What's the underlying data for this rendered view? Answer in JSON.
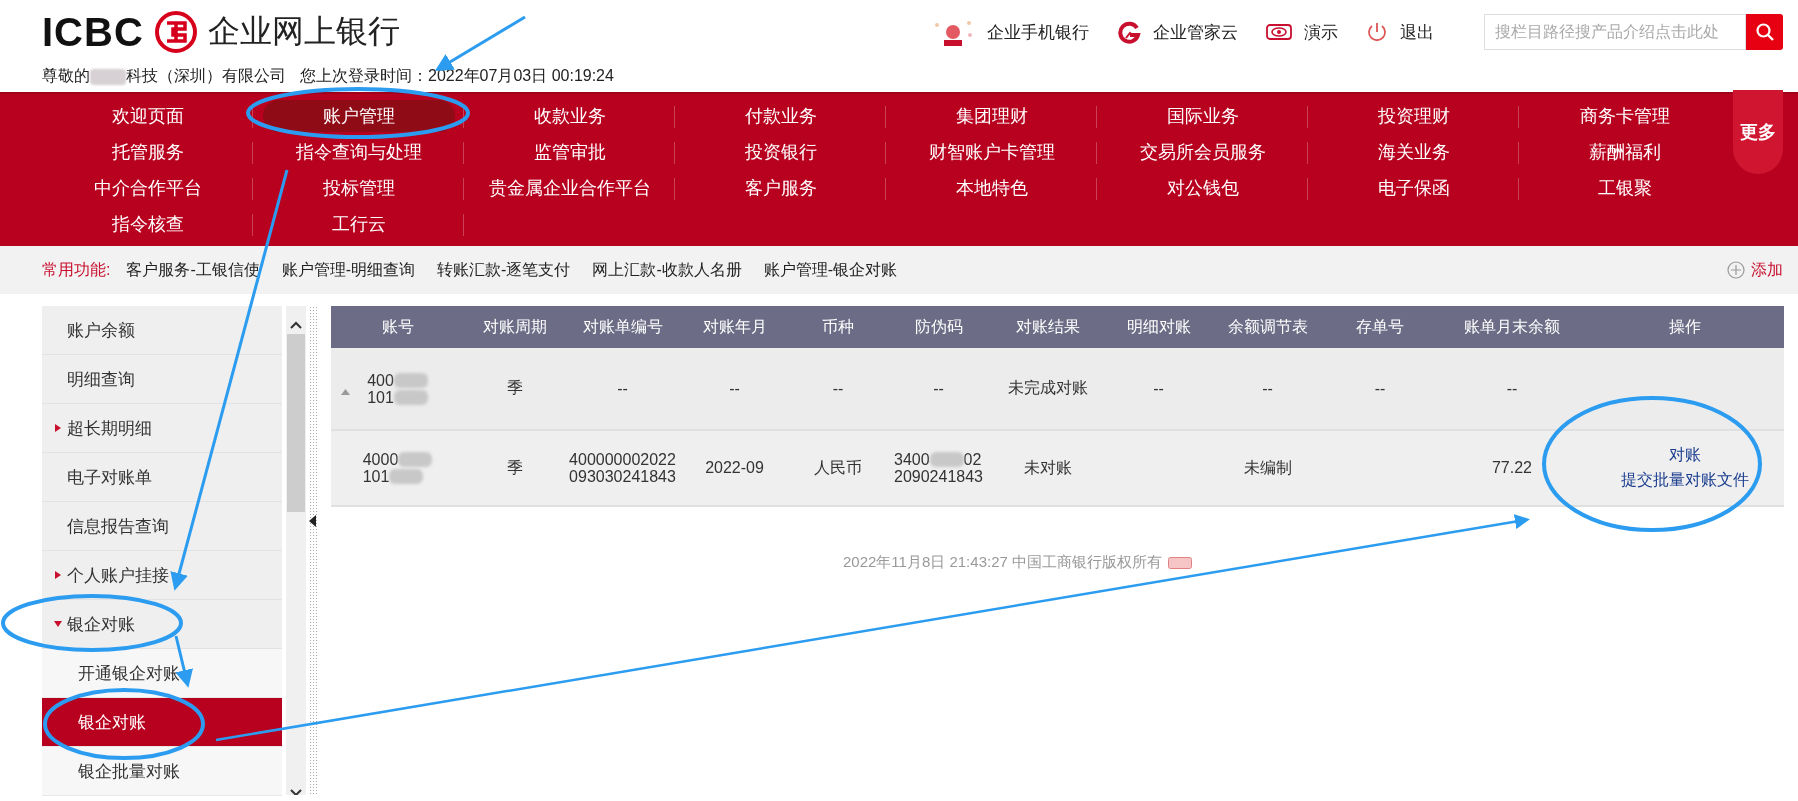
{
  "header": {
    "logo_text": "ICBC",
    "product": "企业网上银行",
    "greeting": {
      "before": "尊敬的",
      "redacted": true,
      "after": "科技（深圳）有限公司",
      "last_login_label": "您上次登录时间：",
      "last_login": "2022年07月03日 00:19:24"
    },
    "links": [
      {
        "kind": "mobile",
        "label": "企业手机银行"
      },
      {
        "kind": "cloud",
        "label": "企业管家云"
      },
      {
        "kind": "eye",
        "label": "演示"
      },
      {
        "kind": "power",
        "label": "退出"
      }
    ],
    "search": {
      "placeholder": "搜栏目路径搜产品介绍点击此处"
    }
  },
  "nav": {
    "items": [
      {
        "label": "欢迎页面",
        "selected": false
      },
      {
        "label": "账户管理",
        "selected": true
      },
      {
        "label": "收款业务",
        "selected": false
      },
      {
        "label": "付款业务",
        "selected": false
      },
      {
        "label": "集团理财",
        "selected": false
      },
      {
        "label": "国际业务",
        "selected": false
      },
      {
        "label": "投资理财",
        "selected": false
      },
      {
        "label": "商务卡管理",
        "selected": false
      },
      {
        "label": "托管服务",
        "selected": false
      },
      {
        "label": "指令查询与处理",
        "selected": false
      },
      {
        "label": "监管审批",
        "selected": false
      },
      {
        "label": "投资银行",
        "selected": false
      },
      {
        "label": "财智账户卡管理",
        "selected": false
      },
      {
        "label": "交易所会员服务",
        "selected": false
      },
      {
        "label": "海关业务",
        "selected": false
      },
      {
        "label": "薪酬福利",
        "selected": false
      },
      {
        "label": "中介合作平台",
        "selected": false
      },
      {
        "label": "投标管理",
        "selected": false
      },
      {
        "label": "贵金属企业合作平台",
        "selected": false
      },
      {
        "label": "客户服务",
        "selected": false
      },
      {
        "label": "本地特色",
        "selected": false
      },
      {
        "label": "对公钱包",
        "selected": false
      },
      {
        "label": "电子保函",
        "selected": false
      },
      {
        "label": "工银聚",
        "selected": false
      },
      {
        "label": "指令核查",
        "selected": false
      },
      {
        "label": "工行云",
        "selected": false
      }
    ],
    "more": "更多"
  },
  "shortcuts": {
    "label": "常用功能:",
    "items": [
      "客户服务-工银信使",
      "账户管理-明细查询",
      "转账汇款-逐笔支付",
      "网上汇款-收款人名册",
      "账户管理-银企对账"
    ],
    "add": "添加"
  },
  "sidebar": {
    "items": [
      {
        "label": "账户余额"
      },
      {
        "label": "明细查询"
      },
      {
        "label": "超长期明细",
        "expanded": false
      },
      {
        "label": "电子对账单"
      },
      {
        "label": "信息报告查询"
      },
      {
        "label": "个人账户挂接",
        "expanded": false
      },
      {
        "label": "银企对账",
        "expanded": true,
        "children": [
          {
            "label": "开通银企对账",
            "selected": false
          },
          {
            "label": "银企对账",
            "selected": true
          },
          {
            "label": "银企批量对账",
            "selected": false
          }
        ]
      }
    ]
  },
  "table": {
    "columns": [
      "账号",
      "对账周期",
      "对账单编号",
      "对账年月",
      "币种",
      "防伪码",
      "对账结果",
      "明细对账",
      "余额调节表",
      "存单号",
      "账单月末余额",
      "操作"
    ],
    "rows": [
      {
        "expanded": true,
        "cells": [
          {
            "kind": "masked",
            "lines": [
              [
                "400",
                {
                  "kind": "blur"
                }
              ],
              [
                "101",
                {
                  "kind": "blur"
                }
              ]
            ]
          },
          "季",
          "--",
          "--",
          "--",
          "--",
          "未完成对账",
          "--",
          "--",
          "--",
          "--",
          null
        ]
      },
      {
        "cells": [
          {
            "kind": "masked",
            "lines": [
              [
                "4000",
                {
                  "kind": "blur"
                }
              ],
              [
                "101",
                {
                  "kind": "blur"
                }
              ]
            ]
          },
          "季",
          {
            "kind": "masked",
            "lines": [
              [
                "400000002022"
              ],
              [
                "093030241843"
              ]
            ]
          },
          "2022-09",
          "人民币",
          {
            "kind": "masked",
            "lines": [
              [
                "3400",
                {
                  "kind": "blur"
                },
                "02"
              ],
              [
                "2090241843"
              ]
            ]
          },
          "未对账",
          null,
          "未编制",
          null,
          "77.22",
          {
            "kind": "links",
            "links": [
              "对账",
              "提交批量对账文件"
            ]
          }
        ]
      }
    ]
  },
  "footer": {
    "text": "2022年11月8日 21:43:27 中国工商银行版权所有"
  }
}
